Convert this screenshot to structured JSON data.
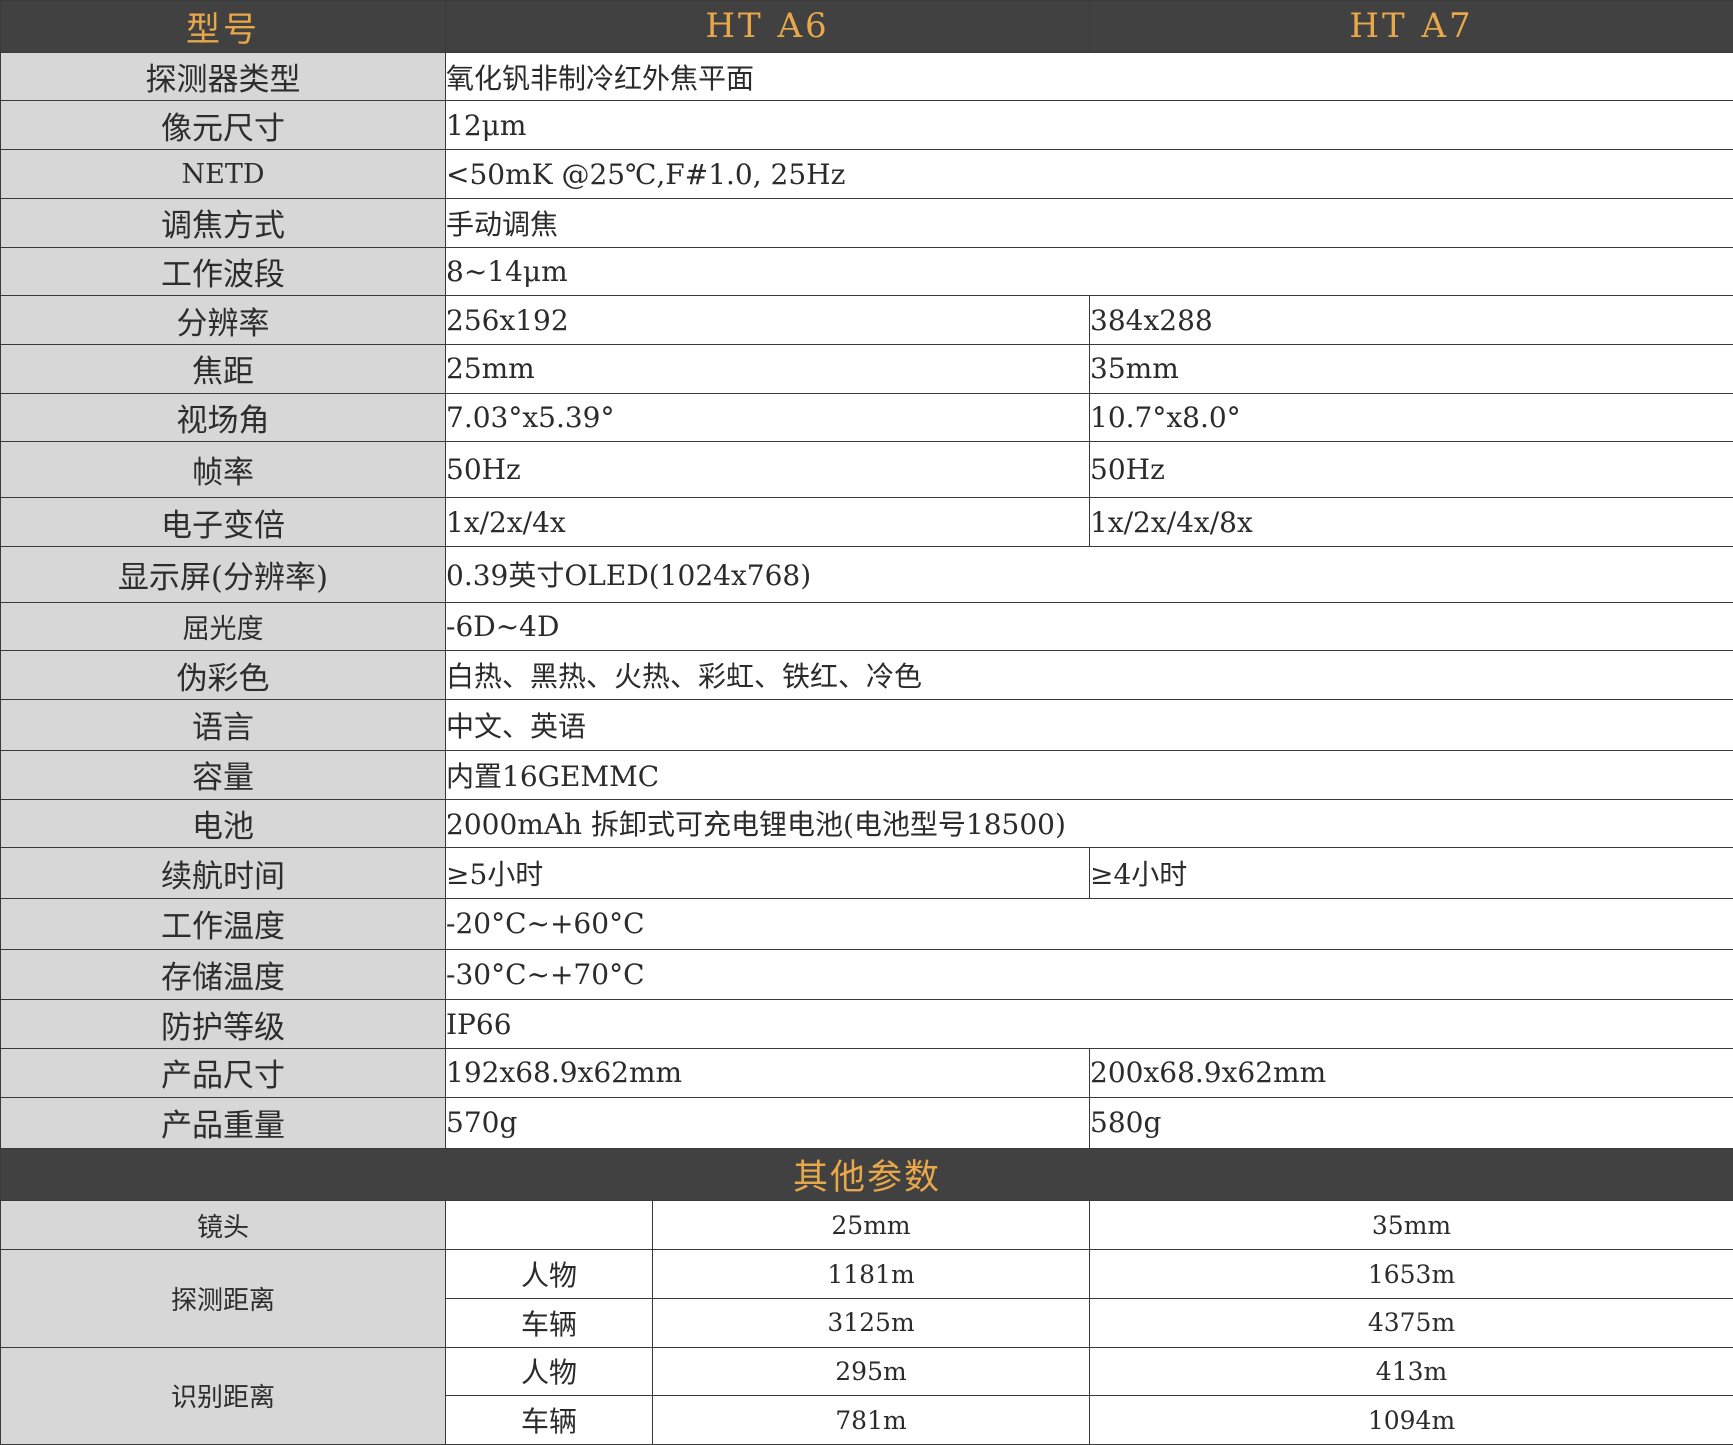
{
  "header": {
    "model_label": "型号",
    "models": [
      "HT A6",
      "HT A7"
    ]
  },
  "rows": [
    {
      "label": "探测器类型",
      "shared": "氧化钒非制冷红外焦平面"
    },
    {
      "label": "像元尺寸",
      "shared": "12μm"
    },
    {
      "label": "NETD",
      "shared": "<50mK @25℃,F#1.0, 25Hz"
    },
    {
      "label": "调焦方式",
      "shared": "手动调焦"
    },
    {
      "label": "工作波段",
      "shared": "8~14μm"
    },
    {
      "label": "分辨率",
      "a6": "256x192",
      "a7": "384x288"
    },
    {
      "label": "焦距",
      "a6": "25mm",
      "a7": "35mm"
    },
    {
      "label": "视场角",
      "a6": "7.03°x5.39°",
      "a7": "10.7°x8.0°"
    },
    {
      "label": "帧率",
      "a6": "50Hz",
      "a7": "50Hz"
    },
    {
      "label": "电子变倍",
      "a6": "1x/2x/4x",
      "a7": "1x/2x/4x/8x"
    },
    {
      "label": "显示屏(分辨率)",
      "shared": "0.39英寸OLED(1024x768)"
    },
    {
      "label": "屈光度",
      "shared": "-6D~4D"
    },
    {
      "label": "伪彩色",
      "shared": "白热、黑热、火热、彩虹、铁红、冷色"
    },
    {
      "label": "语言",
      "shared": "中文、英语"
    },
    {
      "label": "容量",
      "shared": "内置16GEMMC"
    },
    {
      "label": "电池",
      "shared": "2000mAh 拆卸式可充电锂电池(电池型号18500)"
    },
    {
      "label": "续航时间",
      "a6": "≥5小时",
      "a7": "≥4小时"
    },
    {
      "label": "工作温度",
      "shared": "-20°C~+60°C"
    },
    {
      "label": "存储温度",
      "shared": "-30°C~+70°C"
    },
    {
      "label": "防护等级",
      "shared": "IP66"
    },
    {
      "label": "产品尺寸",
      "a6": "192x68.9x62mm",
      "a7": "200x68.9x62mm"
    },
    {
      "label": "产品重量",
      "a6": "570g",
      "a7": "580g"
    }
  ],
  "other": {
    "title": "其他参数",
    "lens": {
      "label": "镜头",
      "a6": "25mm",
      "a7": "35mm"
    },
    "detection": {
      "label": "探测距离",
      "person": {
        "label": "人物",
        "a6": "1181m",
        "a7": "1653m"
      },
      "vehicle": {
        "label": "车辆",
        "a6": "3125m",
        "a7": "4375m"
      }
    },
    "recognition": {
      "label": "识别距离",
      "person": {
        "label": "人物",
        "a6": "295m",
        "a7": "413m"
      },
      "vehicle": {
        "label": "车辆",
        "a6": "781m",
        "a7": "1094m"
      }
    }
  }
}
